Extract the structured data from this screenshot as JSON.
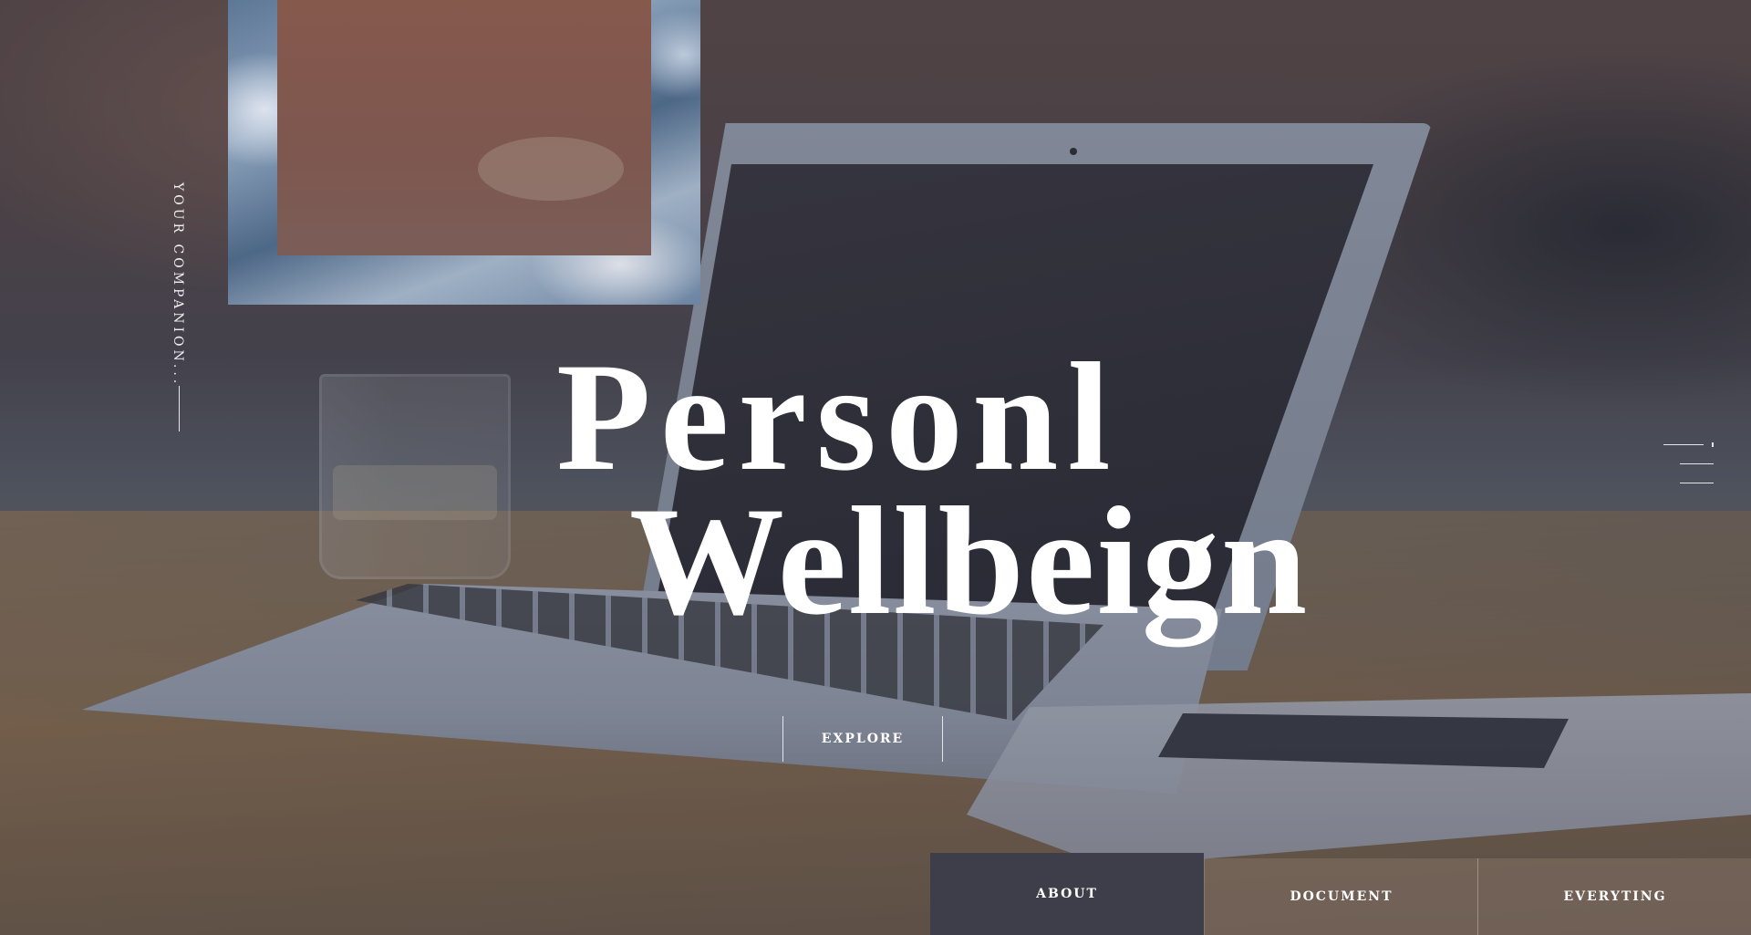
{
  "hero": {
    "title_line1": "Personl",
    "title_line2": "Wellbeign",
    "tagline": "YOUR COMPANION..."
  },
  "actions": {
    "explore_label": "EXPLORE"
  },
  "nav": {
    "tabs": [
      {
        "label": "ABOUT",
        "active": true
      },
      {
        "label": "DOCUMENT",
        "active": false
      },
      {
        "label": "EVERYTING",
        "active": false
      }
    ]
  },
  "icons": {
    "menu": "menu-icon"
  },
  "colors": {
    "active_tab": "#3d3e49",
    "text": "#ffffff"
  }
}
